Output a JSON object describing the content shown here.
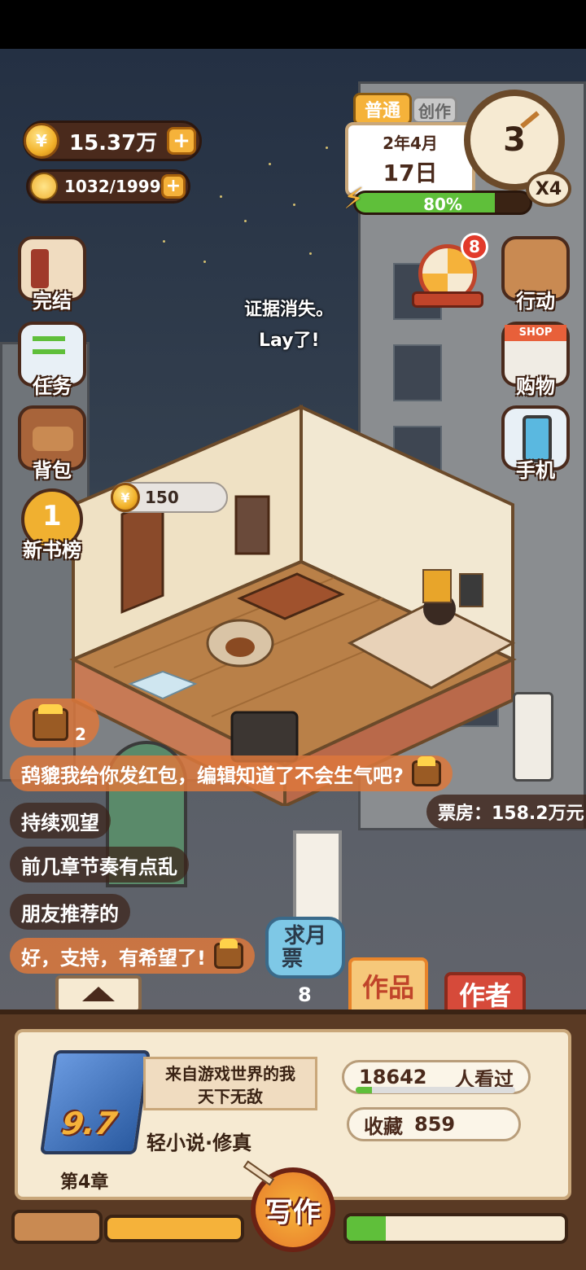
{
  "resources": {
    "coins": "15.37万",
    "energy": "1032/1999"
  },
  "date_panel": {
    "mode": "普通",
    "behind_tab": "创作",
    "year_month": "2年4月",
    "day": "17日",
    "stamina_percent": "80%",
    "stamina_fraction": 0.8,
    "clock_number": "3",
    "speed": "X4"
  },
  "left_menu": [
    {
      "label": "完结",
      "icon": "book-icon"
    },
    {
      "label": "任务",
      "icon": "clipboard-icon"
    },
    {
      "label": "背包",
      "icon": "bag-icon"
    },
    {
      "label": "新书榜",
      "icon": "trophy-coin-icon"
    }
  ],
  "right_menu": [
    {
      "label": "行动",
      "icon": "door-icon"
    },
    {
      "label": "购物",
      "icon": "shop-icon",
      "sign": "SHOP"
    },
    {
      "label": "手机",
      "icon": "phone-icon"
    }
  ],
  "wheel_badge": "8",
  "float_texts": [
    "证据消失。",
    "Lay了!"
  ],
  "room_coin_bubble": "150",
  "chest_count": "2",
  "comments": [
    "鸹貔我给你发红包，编辑知道了不会生气吧?",
    "持续观望",
    "前几章节奏有点乱",
    "朋友推荐的",
    "好，支持，有希望了!"
  ],
  "box_office": "票房：158.2万元",
  "monthly_ticket": {
    "label_line1": "求月",
    "label_line2": "票",
    "count": "8"
  },
  "tabs": {
    "works": "作品",
    "author": "作者"
  },
  "book": {
    "rating": "9.7",
    "title_line1": "来自游戏世界的我",
    "title_line2": "天下无敌",
    "genre": "轻小说·修真",
    "chapter": "第4章",
    "viewers": "18642",
    "viewers_label": "人看过",
    "favorites_label": "收藏",
    "favorites": "859"
  },
  "write_button": "写作",
  "colors": {
    "accent_orange": "#f5b23a",
    "panel_brown": "#5a3a24",
    "red_tab": "#d64a3a",
    "green_bar": "#5fbf3a"
  }
}
